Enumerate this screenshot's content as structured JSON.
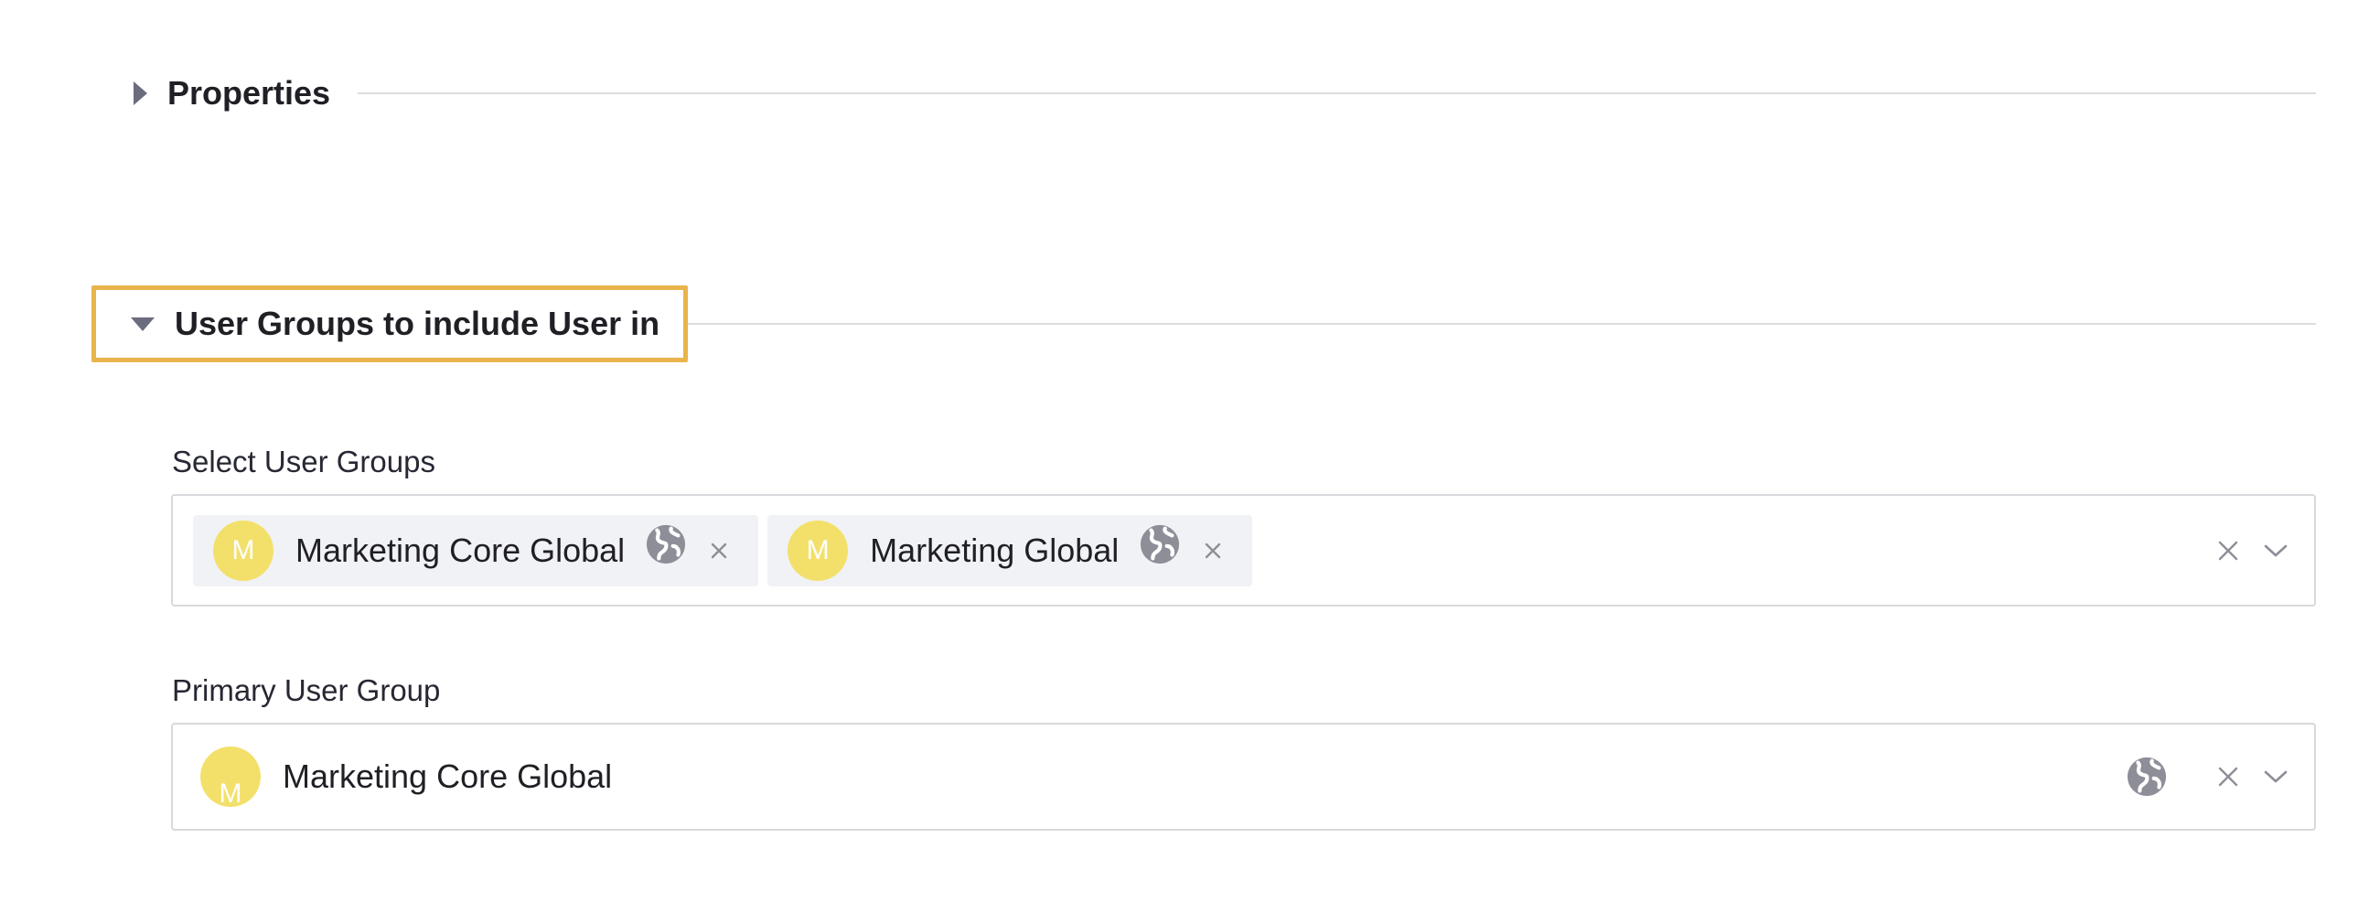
{
  "sections": {
    "properties": {
      "title": "Properties",
      "expanded": false
    },
    "user_groups": {
      "title": "User Groups to include User in",
      "expanded": true
    }
  },
  "select_user_groups": {
    "label": "Select User Groups",
    "selected": [
      {
        "avatar_letter": "M",
        "name": "Marketing Core Global",
        "icon": "globe-icon"
      },
      {
        "avatar_letter": "M",
        "name": "Marketing Global",
        "icon": "globe-icon"
      }
    ]
  },
  "primary_user_group": {
    "label": "Primary User Group",
    "value": {
      "avatar_letter": "M",
      "name": "Marketing Core Global",
      "icon": "globe-icon"
    }
  },
  "colors": {
    "highlight_border": "#e9b44c",
    "avatar_bg": "#f3e06b",
    "icon_gray": "#8e8e98"
  }
}
